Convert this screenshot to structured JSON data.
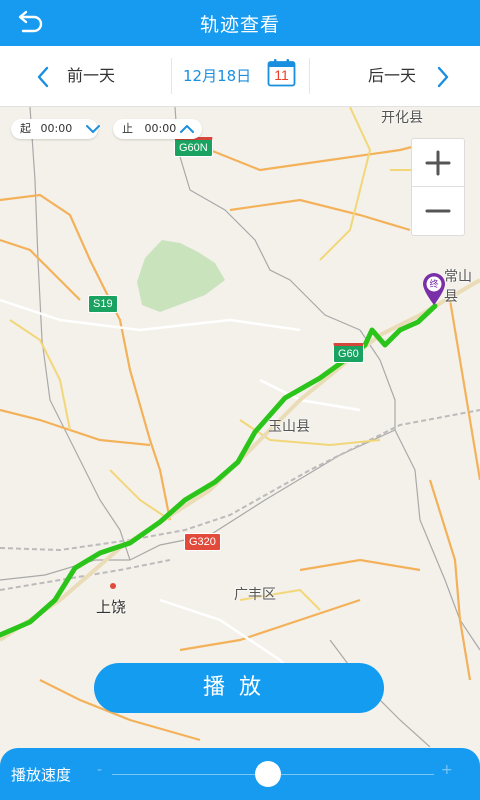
{
  "header": {
    "title": "轨迹查看",
    "back_icon": "back-arrow-icon"
  },
  "datebar": {
    "prev_label": "前一天",
    "date": "12月18日",
    "calendar_day": "11",
    "next_label": "后一天"
  },
  "time_filter": {
    "start_label": "起",
    "start_time": "00:00",
    "end_label": "止",
    "end_time": "00:00"
  },
  "map": {
    "zoom_in": "+",
    "zoom_out": "−",
    "places": {
      "kaihua": "开化县",
      "changshan": "常山县",
      "yushan": "玉山县",
      "shangrao": "上饶",
      "guangfeng": "广丰区"
    },
    "roads": {
      "g60n": "G60N",
      "s19": "S19",
      "g60": "G60",
      "g320": "G320"
    },
    "end_marker": "终",
    "track_color": "#2bc41a"
  },
  "play_button": "播放",
  "speed": {
    "label": "播放速度",
    "min_symbol": "-",
    "max_symbol": "+"
  },
  "colors": {
    "accent": "#169bf0",
    "date": "#1a8fe0"
  }
}
